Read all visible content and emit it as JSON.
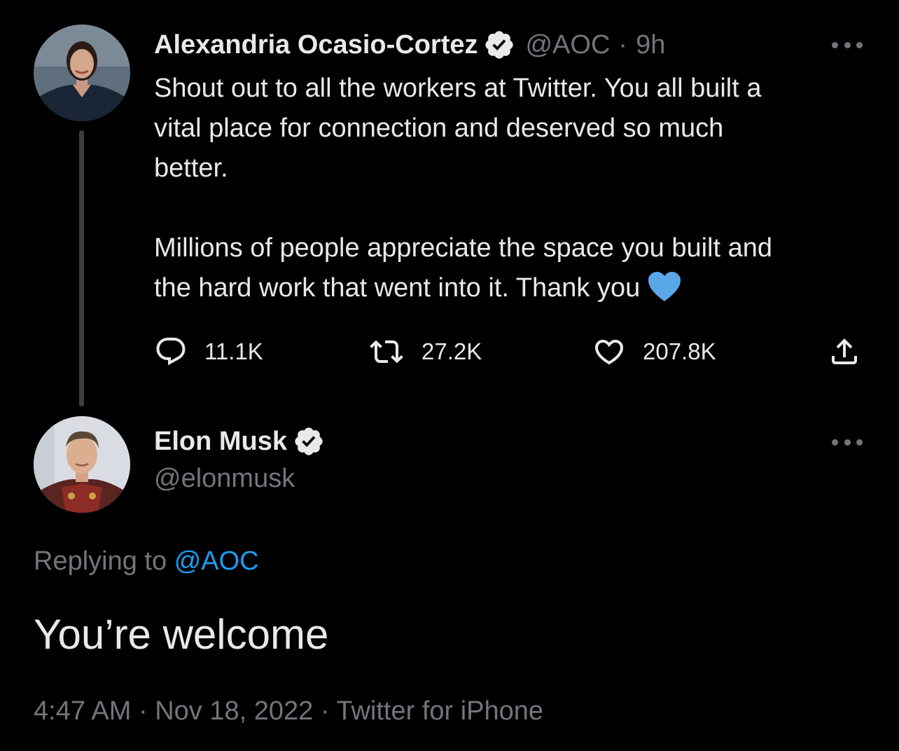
{
  "original_tweet": {
    "author_name": "Alexandria Ocasio-Cortez",
    "handle": "@AOC",
    "separator": "·",
    "age": "9h",
    "body_lines": [
      "Shout out to all the workers at Twitter. You all built a",
      "vital place for connection and deserved so much",
      "better.",
      "Millions of people appreciate the space you built and",
      "the hard work that went into it. Thank you"
    ],
    "emoji": "blue-heart",
    "emoji_color": "#5aa7e8",
    "actions": {
      "replies": "11.1K",
      "retweets": "27.2K",
      "likes": "207.8K"
    }
  },
  "reply_tweet": {
    "author_name": "Elon Musk",
    "handle": "@elonmusk",
    "replying_prefix": "Replying to",
    "replying_mention": "@AOC",
    "text": "You’re welcome",
    "time": "4:47 AM",
    "date": "Nov 18, 2022",
    "source": "Twitter for iPhone",
    "meta_separator": " · "
  },
  "colors": {
    "background": "#000000",
    "primary_text": "#e7e9ea",
    "secondary_text": "#71767b",
    "link": "#1d9bf0",
    "thread_line": "#3b3f44"
  }
}
